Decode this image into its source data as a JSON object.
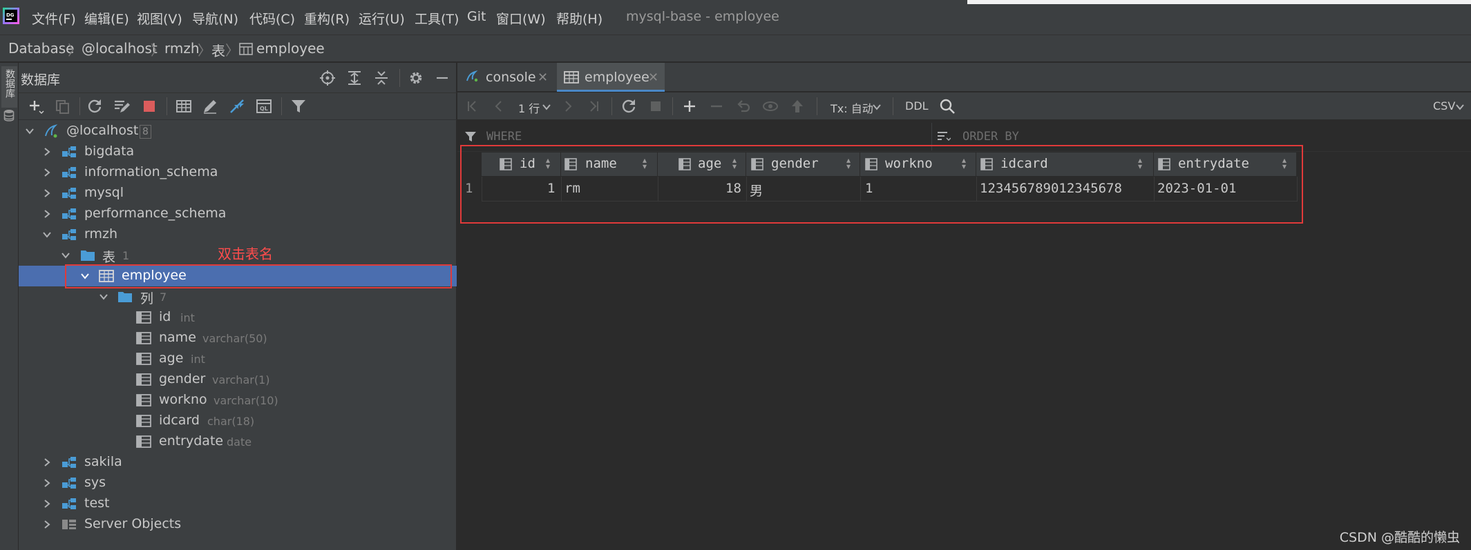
{
  "menubar": {
    "items": [
      "文件(F)",
      "编辑(E)",
      "视图(V)",
      "导航(N)",
      "代码(C)",
      "重构(R)",
      "运行(U)",
      "工具(T)",
      "Git",
      "窗口(W)",
      "帮助(H)"
    ],
    "window_title": "mysql-base - employee"
  },
  "breadcrumb": [
    "Database",
    "@localhost",
    "rmzh",
    "表",
    "employee"
  ],
  "side_strip": {
    "tab_label": "数据库"
  },
  "db_panel": {
    "title": "数据库",
    "tree": {
      "root": {
        "label": "@localhost",
        "count": "8"
      },
      "schemas": [
        "bigdata",
        "information_schema",
        "mysql",
        "performance_schema",
        "rmzh"
      ],
      "tables_folder": {
        "label": "表",
        "count": "1"
      },
      "table": "employee",
      "columns_folder": {
        "label": "列",
        "count": "7"
      },
      "columns": [
        {
          "name": "id",
          "type": "int"
        },
        {
          "name": "name",
          "type": "varchar(50)"
        },
        {
          "name": "age",
          "type": "int"
        },
        {
          "name": "gender",
          "type": "varchar(1)"
        },
        {
          "name": "workno",
          "type": "varchar(10)"
        },
        {
          "name": "idcard",
          "type": "char(18)"
        },
        {
          "name": "entrydate",
          "type": "date"
        }
      ],
      "more_schemas": [
        "sakila",
        "sys",
        "test"
      ],
      "server_objects": "Server Objects"
    },
    "annotation": "双击表名"
  },
  "editor": {
    "tabs": [
      {
        "label": "console"
      },
      {
        "label": "employee",
        "active": true
      }
    ],
    "toolbar": {
      "rows_label": "1 行",
      "tx_label": "Tx: 自动",
      "ddl_label": "DDL",
      "export_label": "CSV"
    },
    "filter": {
      "where": "WHERE",
      "order_by": "ORDER BY"
    },
    "grid": {
      "columns": [
        "id",
        "name",
        "age",
        "gender",
        "workno",
        "idcard",
        "entrydate"
      ],
      "rows": [
        {
          "row_number": "1",
          "cells": [
            "1",
            "rm",
            "18",
            "男",
            "1",
            "123456789012345678",
            "2023-01-01"
          ]
        }
      ]
    }
  },
  "watermark": "CSDN @酷酷的懒虫",
  "colors": {
    "selection": "#4b6eaf",
    "annotation": "#e03a3a",
    "tab_accent": "#4a88c7"
  }
}
